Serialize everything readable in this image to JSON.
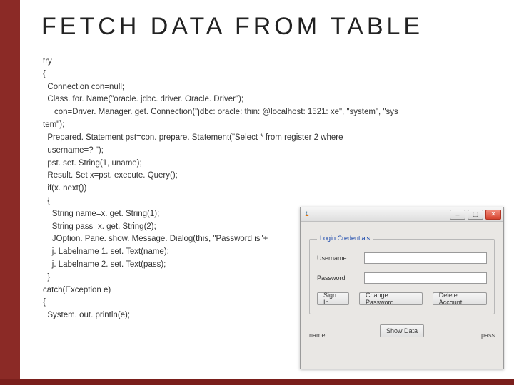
{
  "title": "FETCH DATA FROM TABLE",
  "code": {
    "l1": "try",
    "l2": "{",
    "l3": "  Connection con=null;",
    "l4": "  Class. for. Name(\"oracle. jdbc. driver. Oracle. Driver\");",
    "l5": "     con=Driver. Manager. get. Connection(\"jdbc: oracle: thin: @localhost: 1521: xe\", \"system\", \"sys",
    "l5b": "tem\");",
    "l6": "  Prepared. Statement pst=con. prepare. Statement(\"Select * from register 2 where",
    "l6b": "  username=? \");",
    "l7": "  pst. set. String(1, uname);",
    "l8": "  Result. Set x=pst. execute. Query();",
    "l9": "  if(x. next())",
    "l10": "  {",
    "l11": "    String name=x. get. String(1);",
    "l12": "    String pass=x. get. String(2);",
    "l13": "    JOption. Pane. show. Message. Dialog(this, \"Password is\"+",
    "l14": "    j. Labelname 1. set. Text(name);",
    "l15": "    j. Labelname 2. set. Text(pass);",
    "l16": "  }",
    "l17": "catch(Exception e)",
    "l18": "{",
    "l19": "  System. out. println(e);"
  },
  "app": {
    "group_title": "Login Credentials",
    "username_lbl": "Username",
    "password_lbl": "Password",
    "signin": "Sign In",
    "changepw": "Change Password",
    "deleteacct": "Delete Account",
    "showdata": "Show Data",
    "name_bottom": "name",
    "pass_bottom": "pass"
  }
}
